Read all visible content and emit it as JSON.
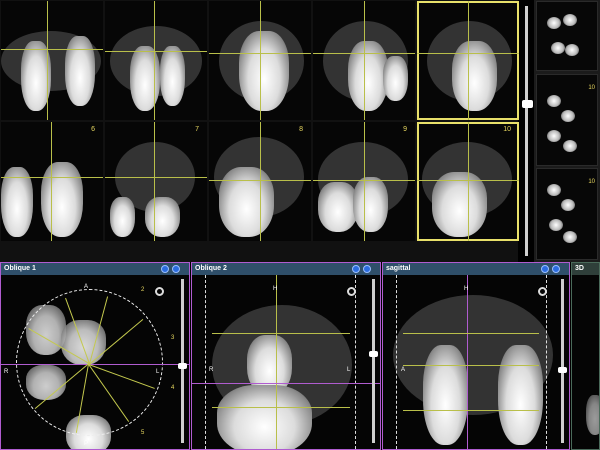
{
  "slices": {
    "numbers": [
      "6",
      "7",
      "8",
      "9",
      "10"
    ],
    "selected": "10"
  },
  "thumbnails": {
    "numbers": [
      "10",
      "10"
    ]
  },
  "panels": {
    "oblique1": {
      "title": "Oblique 1",
      "labels": {
        "top": "A",
        "right": "L",
        "left": "R",
        "bottom": "P"
      },
      "ray_numbers": [
        "2",
        "3",
        "4",
        "5"
      ]
    },
    "oblique2": {
      "title": "Oblique 2",
      "labels": {
        "top": "H",
        "left": "R",
        "right": "L"
      }
    },
    "sagittal": {
      "title": "sagittal",
      "labels": {
        "top": "H",
        "left": "A"
      }
    },
    "view3d": {
      "title": "3D"
    }
  },
  "colors": {
    "header": "#2f4f6a",
    "crosshair": "#b9bf4a",
    "oblique_border": "#b05cd0",
    "slice_number": "#e8d860"
  }
}
